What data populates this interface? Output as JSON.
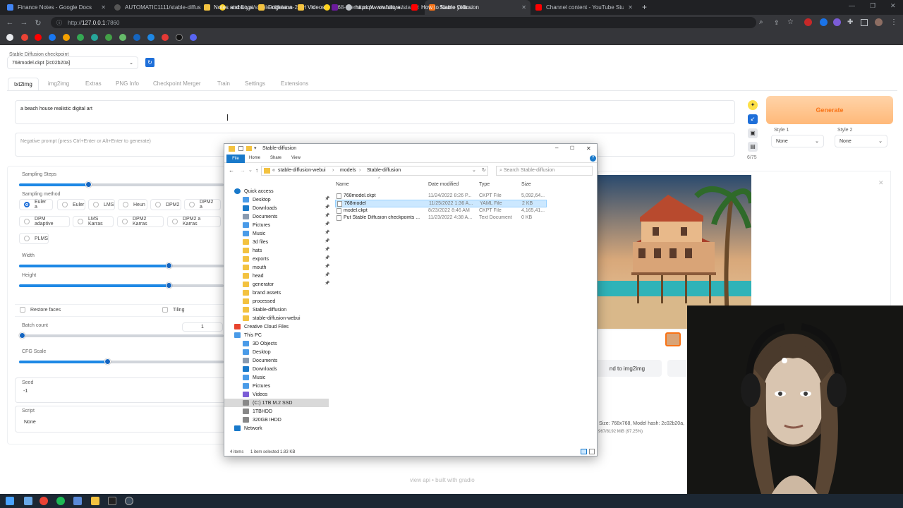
{
  "browser": {
    "tabs": [
      {
        "title": "Finance Notes - Google Docs",
        "color": "#4285f4"
      },
      {
        "title": "AUTOMATIC1111/stable-diffusion",
        "color": "#24292e"
      },
      {
        "title": "stabilityai/stable-diffusion-2 · H",
        "color": "#ffd21e"
      },
      {
        "title": "768-v-ema.ckpt · stabilityai/stab",
        "color": "#ffd21e"
      },
      {
        "title": "Stable Diffusion",
        "color": "#f97316"
      },
      {
        "title": "Channel content - YouTube Studi",
        "color": "#ff0000"
      }
    ],
    "url_host": "127.0.0.1",
    "url_prefix": "http://",
    "url_port": ":7860",
    "bookmarks": [
      "Notes and Logs",
      "Dogelana",
      "Videos",
      "https://www.future...",
      "How to Name your..."
    ]
  },
  "webui": {
    "checkpoint_label": "Stable Diffusion checkpoint",
    "checkpoint_value": "768model.ckpt [2c02b20a]",
    "tabs": [
      "txt2img",
      "img2img",
      "Extras",
      "PNG Info",
      "Checkpoint Merger",
      "Train",
      "Settings",
      "Extensions"
    ],
    "prompt": "a beach house realistic digital art",
    "negative_placeholder": "Negative prompt (press Ctrl+Enter or Alt+Enter to generate)",
    "token_count": "6/75",
    "generate_label": "Generate",
    "style1_label": "Style 1",
    "style2_label": "Style 2",
    "style1_value": "None",
    "style2_value": "None",
    "sampling_steps_label": "Sampling Steps",
    "sampling_method_label": "Sampling method",
    "samplers": [
      "Euler a",
      "Euler",
      "LMS",
      "Heun",
      "DPM2",
      "DPM2 a",
      "DPM adaptive",
      "LMS Karras",
      "DPM2 Karras",
      "DPM2 a Karras",
      "PLMS"
    ],
    "width_label": "Width",
    "height_label": "Height",
    "restore_faces_label": "Restore faces",
    "tiling_label": "Tiling",
    "batch_count_label": "Batch count",
    "batch_count_value": "1",
    "cfg_scale_label": "CFG Scale",
    "seed_label": "Seed",
    "seed_value": "-1",
    "script_label": "Script",
    "script_value": "None",
    "send_img2img_label": "nd to img2img",
    "info_line1": "Size: 768x768, Model hash: 2c02b20a,",
    "info_line2": "967/8192 MiB (97.25%)",
    "footer": "view api  •  built with gradio"
  },
  "explorer": {
    "title": "Stable-diffusion",
    "ribbon_tabs": [
      "File",
      "Home",
      "Share",
      "View"
    ],
    "path": [
      "stable-diffusion-webui",
      "models",
      "Stable-diffusion"
    ],
    "search_placeholder": "Search Stable-diffusion",
    "nav_items": [
      {
        "label": "Quick access",
        "type": "star",
        "pinned": false
      },
      {
        "label": "Desktop",
        "type": "blue",
        "pinned": true
      },
      {
        "label": "Downloads",
        "type": "down",
        "pinned": true
      },
      {
        "label": "Documents",
        "type": "doc",
        "pinned": true
      },
      {
        "label": "Pictures",
        "type": "pic",
        "pinned": true
      },
      {
        "label": "Music",
        "type": "music",
        "pinned": true
      },
      {
        "label": "3d files",
        "type": "folder",
        "pinned": true
      },
      {
        "label": "hats",
        "type": "folder",
        "pinned": true
      },
      {
        "label": "exports",
        "type": "folder",
        "pinned": true
      },
      {
        "label": "mouth",
        "type": "folder",
        "pinned": true
      },
      {
        "label": "head",
        "type": "folder",
        "pinned": true
      },
      {
        "label": "generator",
        "type": "folder",
        "pinned": true
      },
      {
        "label": "brand assets",
        "type": "folder",
        "pinned": false
      },
      {
        "label": "processed",
        "type": "folder",
        "pinned": false
      },
      {
        "label": "Stable-diffusion",
        "type": "folder",
        "pinned": false
      },
      {
        "label": "stable-diffusion-webui",
        "type": "folder",
        "pinned": false
      },
      {
        "label": "Creative Cloud Files",
        "type": "cloud",
        "pinned": false
      },
      {
        "label": "This PC",
        "type": "pc",
        "pinned": false
      },
      {
        "label": "3D Objects",
        "type": "blue",
        "pinned": false
      },
      {
        "label": "Desktop",
        "type": "blue",
        "pinned": false
      },
      {
        "label": "Documents",
        "type": "doc",
        "pinned": false
      },
      {
        "label": "Downloads",
        "type": "down",
        "pinned": false
      },
      {
        "label": "Music",
        "type": "music",
        "pinned": false
      },
      {
        "label": "Pictures",
        "type": "pic",
        "pinned": false
      },
      {
        "label": "Videos",
        "type": "video",
        "pinned": false
      },
      {
        "label": "(C:) 1TB M.2 SSD",
        "type": "drive",
        "pinned": false
      },
      {
        "label": "1TBHDD",
        "type": "drive",
        "pinned": false
      },
      {
        "label": "320GB  IHDD",
        "type": "drive",
        "pinned": false
      },
      {
        "label": "Network",
        "type": "net",
        "pinned": false
      }
    ],
    "columns": [
      "Name",
      "Date modified",
      "Type",
      "Size"
    ],
    "files": [
      {
        "name": "768model.ckpt",
        "date": "11/24/2022 8:26 P...",
        "type": "CKPT File",
        "size": "5,092,64..."
      },
      {
        "name": "768model",
        "date": "11/25/2022 1:36 A...",
        "type": "YAML File",
        "size": "2 KB"
      },
      {
        "name": "model.ckpt",
        "date": "8/23/2022 8:46 AM",
        "type": "CKPT File",
        "size": "4,165,41..."
      },
      {
        "name": "Put Stable Diffusion checkpoints ...",
        "date": "11/23/2022 4:38 A...",
        "type": "Text Document",
        "size": "0 KB"
      }
    ],
    "status_items": "4 items",
    "status_selected": "1 item selected  1.83 KB"
  }
}
